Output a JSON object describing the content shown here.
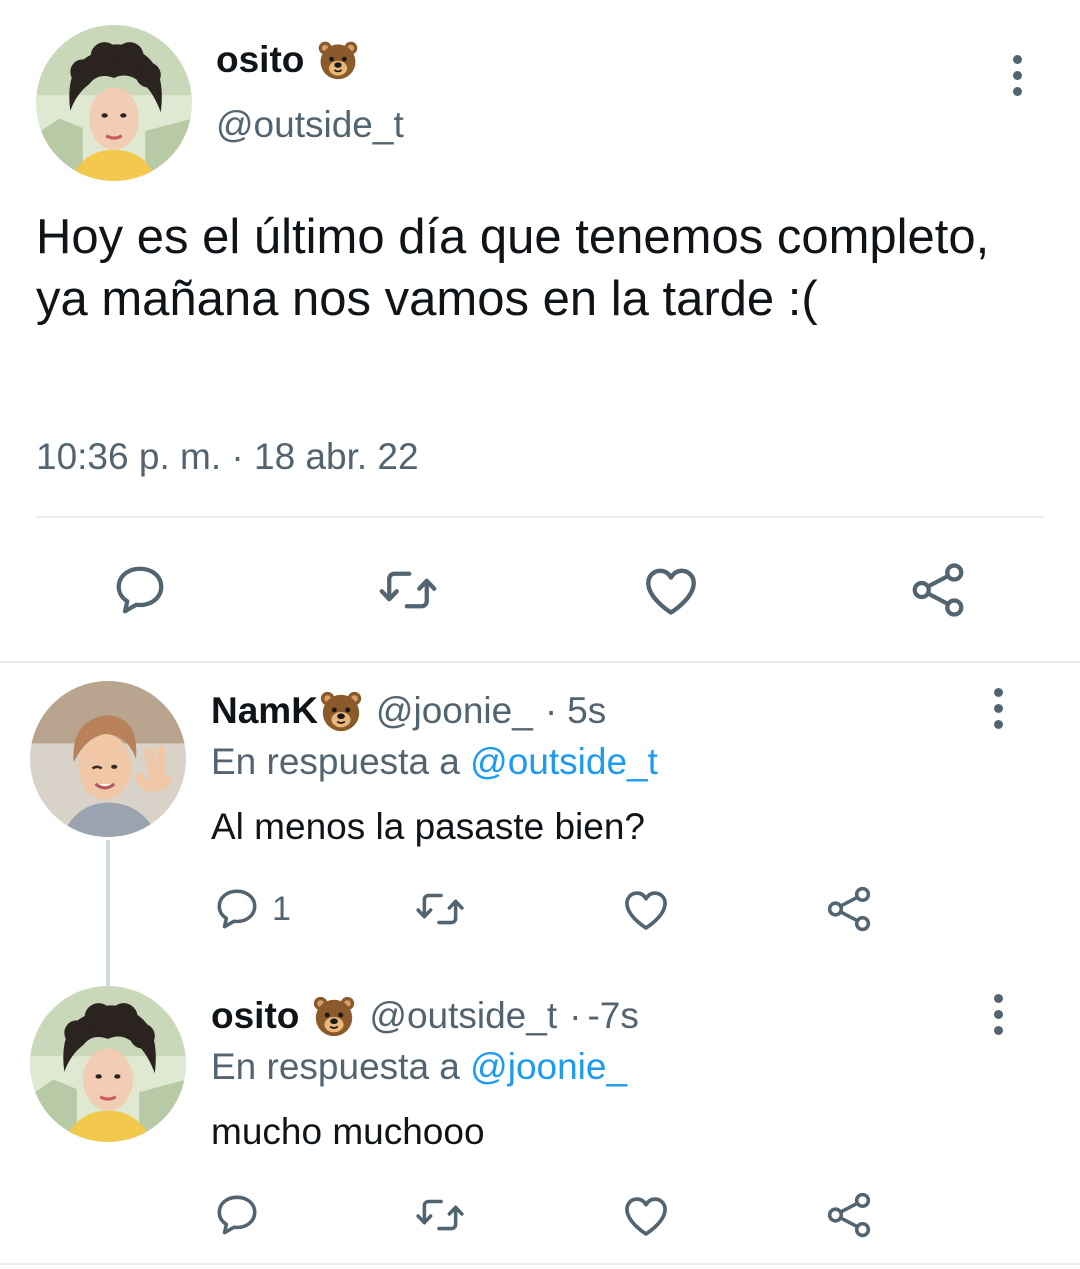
{
  "main_tweet": {
    "display_name": "osito",
    "name_emoji": "bear-face-emoji",
    "handle": "@outside_t",
    "text": "Hoy es el último día que tenemos completo, ya mañana nos vamos en la tarde :(",
    "time": "10:36 p. m.",
    "separator": "·",
    "date": "18 abr. 22",
    "actions": [
      "reply-icon",
      "retweet-icon",
      "like-icon",
      "share-icon"
    ]
  },
  "replies": [
    {
      "display_name": "NamK",
      "name_emoji": "bear-face-emoji",
      "handle": "@joonie_",
      "separator": "·",
      "age": "5s",
      "reply_prefix": "En respuesta a",
      "reply_to": "@outside_t",
      "text": "Al menos la pasaste bien?",
      "reply_count": "1"
    },
    {
      "display_name": "osito",
      "name_emoji": "bear-face-emoji",
      "handle": "@outside_t",
      "separator": "·",
      "age": "-7s",
      "reply_prefix": "En respuesta a",
      "reply_to": "@joonie_",
      "text": "mucho muchooo",
      "reply_count": ""
    }
  ],
  "colors": {
    "primary_text": "#0f1419",
    "secondary_text": "#536471",
    "link": "#1d9bf0",
    "divider": "#e6ecf0"
  }
}
